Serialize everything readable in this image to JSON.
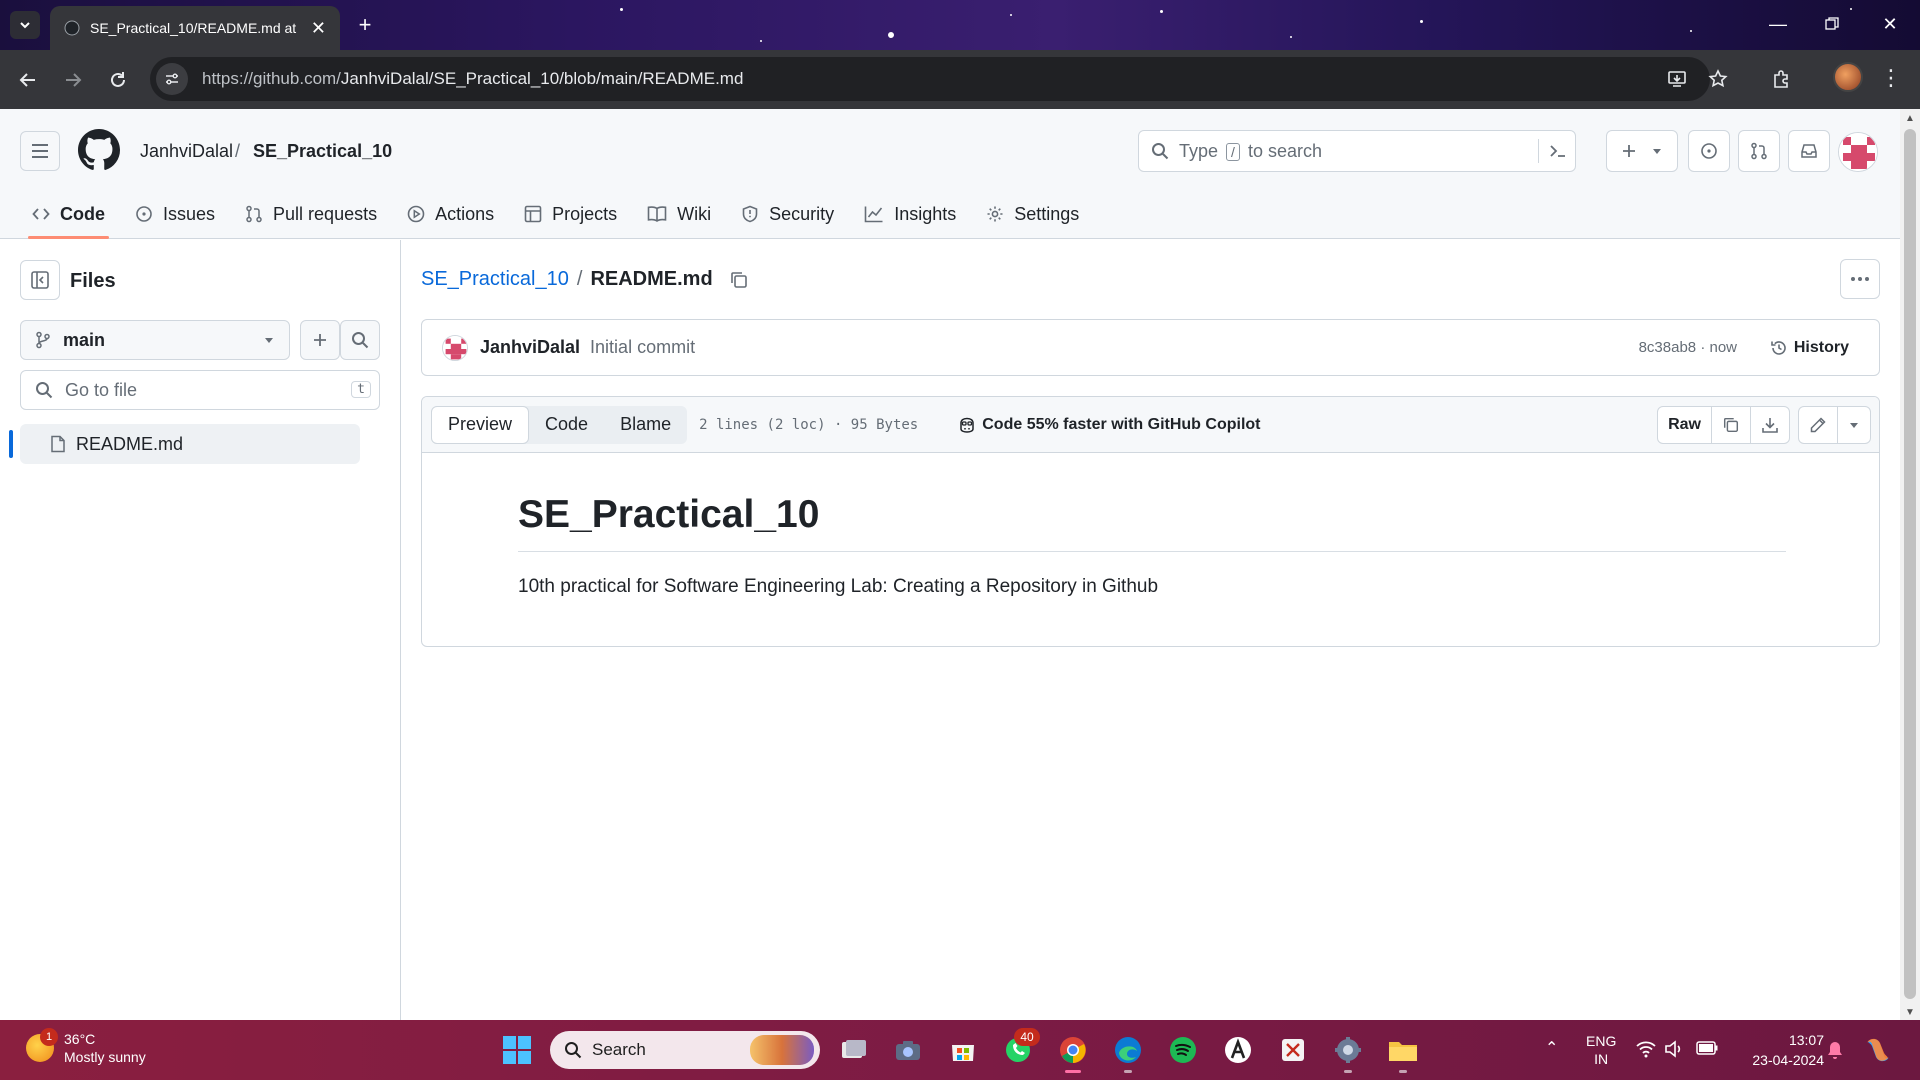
{
  "browser": {
    "tab_title": "SE_Practical_10/README.md at main",
    "url_host": "https://github.com/",
    "url_path": "JanhviDalal/SE_Practical_10/blob/main/README.md"
  },
  "header": {
    "owner": "JanhviDalal",
    "separator": "/",
    "repo": "SE_Practical_10",
    "search_prefix": "Type",
    "search_key": "/",
    "search_suffix": "to search"
  },
  "repo_nav": [
    {
      "label": "Code",
      "icon": "code-icon",
      "active": true
    },
    {
      "label": "Issues",
      "icon": "issue-icon"
    },
    {
      "label": "Pull requests",
      "icon": "pull-request-icon"
    },
    {
      "label": "Actions",
      "icon": "play-icon"
    },
    {
      "label": "Projects",
      "icon": "table-icon"
    },
    {
      "label": "Wiki",
      "icon": "book-icon"
    },
    {
      "label": "Security",
      "icon": "shield-icon"
    },
    {
      "label": "Insights",
      "icon": "graph-icon"
    },
    {
      "label": "Settings",
      "icon": "gear-icon"
    }
  ],
  "sidebar": {
    "title": "Files",
    "branch": "main",
    "goto_placeholder": "Go to file",
    "goto_key": "t",
    "files": [
      {
        "name": "README.md",
        "icon": "file-icon"
      }
    ]
  },
  "breadcrumb": {
    "repo": "SE_Practical_10",
    "separator": "/",
    "file": "README.md"
  },
  "commit": {
    "author": "JanhviDalal",
    "message": "Initial commit",
    "sha_time": "8c38ab8 · now",
    "history_label": "History"
  },
  "file_toolbar": {
    "tabs": [
      "Preview",
      "Code",
      "Blame"
    ],
    "active_tab": "Preview",
    "meta": "2 lines (2 loc) · 95 Bytes",
    "copilot": "Code 55% faster with GitHub Copilot",
    "raw_label": "Raw"
  },
  "readme": {
    "heading": "SE_Practical_10",
    "body": "10th practical for Software Engineering Lab: Creating a Repository in Github"
  },
  "taskbar": {
    "weather_temp": "36°C",
    "weather_desc": "Mostly sunny",
    "weather_badge": "1",
    "search_placeholder": "Search",
    "whatsapp_badge": "40",
    "lang_line1": "ENG",
    "lang_line2": "IN",
    "time": "13:07",
    "date": "23-04-2024"
  },
  "colors": {
    "link": "#0969da",
    "active_tab_underline": "#fd8c73",
    "taskbar": "#7c1b44"
  }
}
